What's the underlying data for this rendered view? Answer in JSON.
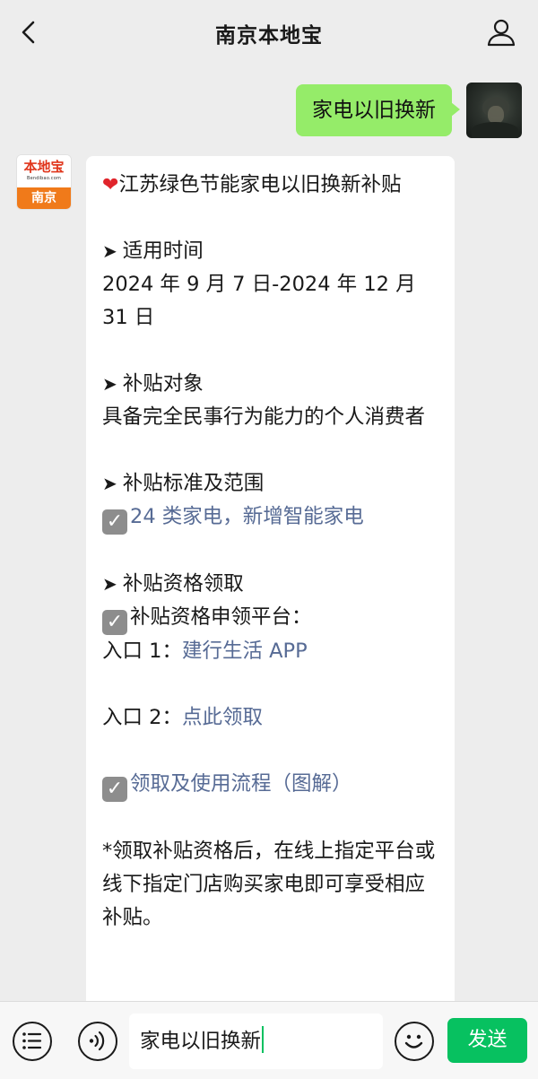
{
  "header": {
    "title": "南京本地宝",
    "back_icon": "chevron-left-icon",
    "user_icon": "person-icon"
  },
  "outgoing_message": {
    "text": "家电以旧换新"
  },
  "bot_avatar": {
    "logo_text": "本地宝",
    "logo_subtext": "Bendibao.com",
    "city": "南京"
  },
  "incoming_message": {
    "title": "江苏绿色节能家电以旧换新补贴",
    "sections": {
      "time_heading": "适用时间",
      "time_value": "2024 年 9 月 7 日-2024 年 12 月 31 日",
      "target_heading": "补贴对象",
      "target_value": "具备完全民事行为能力的个人消费者",
      "scope_heading": "补贴标准及范围",
      "scope_link": "24 类家电，新增智能家电",
      "claim_heading": "补贴资格领取",
      "claim_platform": "补贴资格申领平台：",
      "entry1_label": "入口 1：",
      "entry1_link": "建行生活 APP",
      "entry2_label": "入口 2：",
      "entry2_link": "点此领取",
      "process_link": "领取及使用流程（图解）",
      "note": "*领取补贴资格后，在线上指定平台或线下指定门店购买家电即可享受相应补贴。"
    }
  },
  "input_bar": {
    "menu_icon": "list-menu-icon",
    "voice_icon": "voice-icon",
    "input_value": "家电以旧换新",
    "emoji_icon": "smiley-icon",
    "send_label": "发送"
  },
  "colors": {
    "background": "#ededed",
    "outgoing_bubble": "#95ec69",
    "link": "#576b95",
    "send_button": "#07c160",
    "logo_orange": "#f07a1a"
  }
}
